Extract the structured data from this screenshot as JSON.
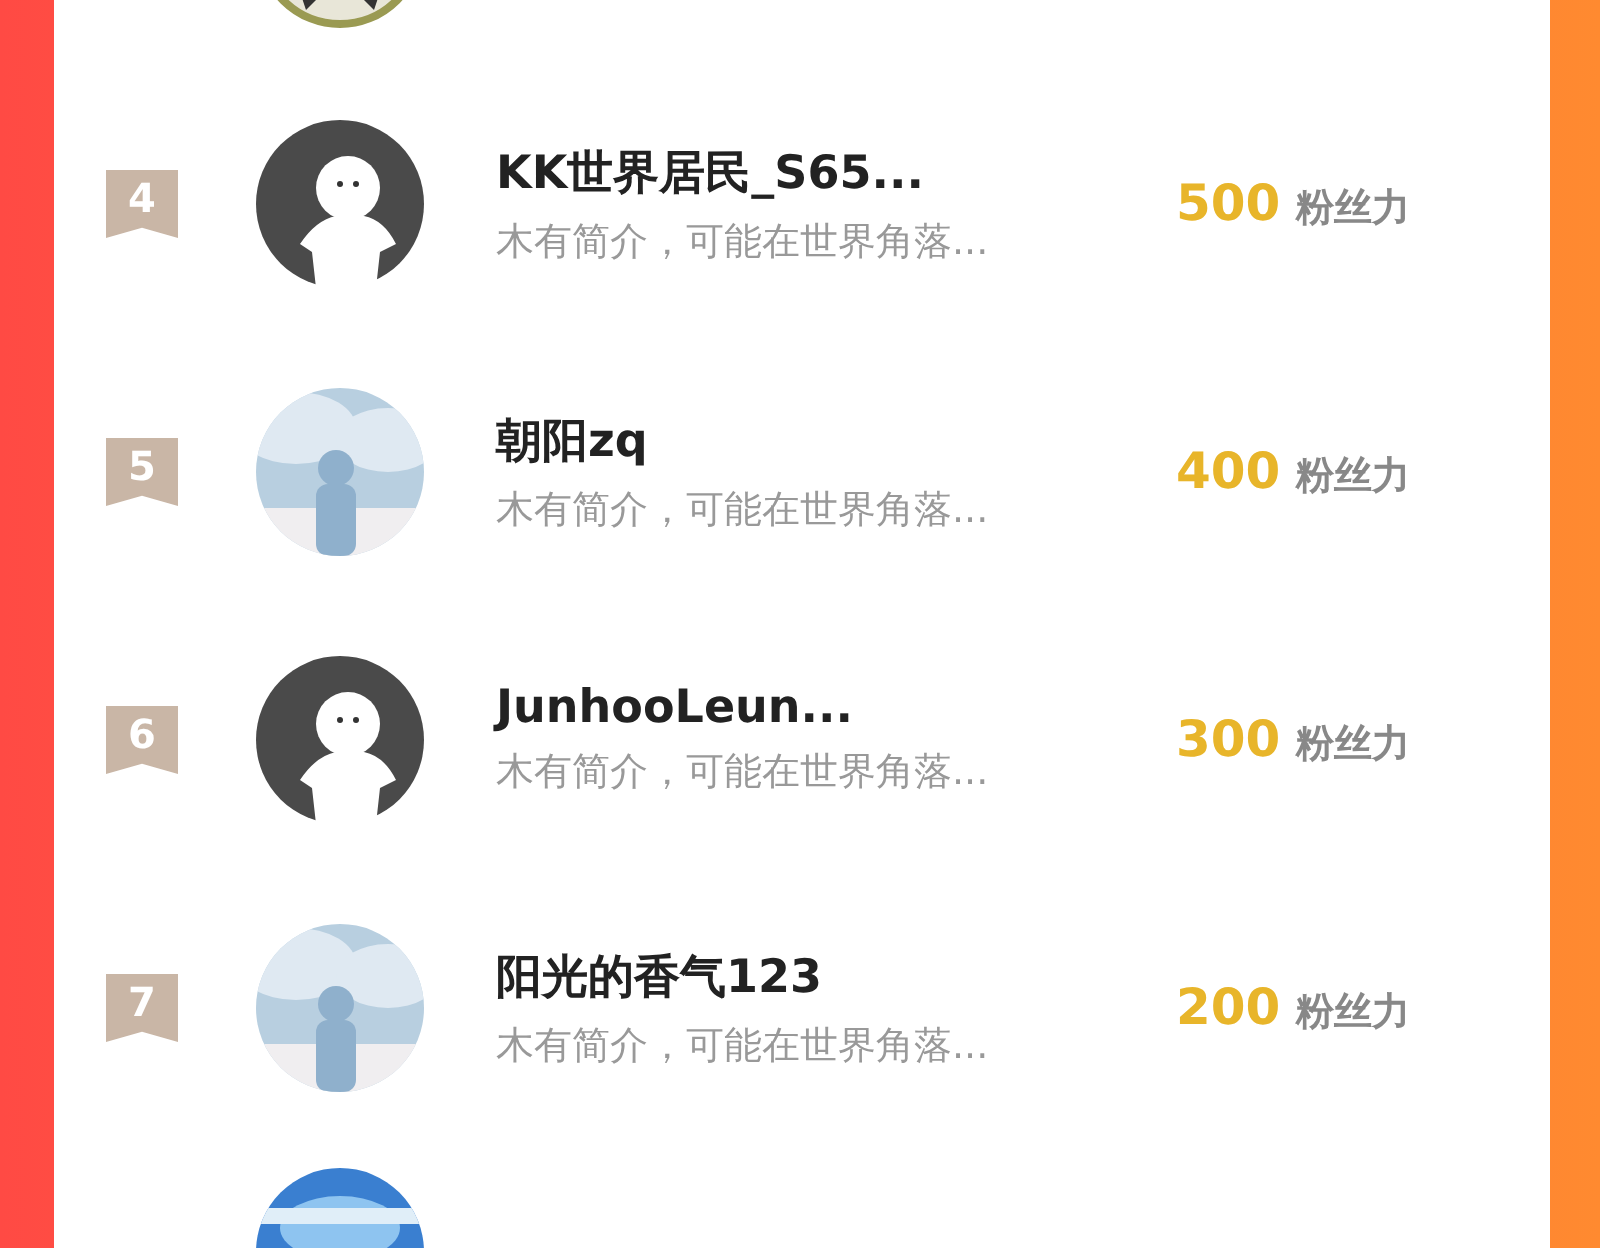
{
  "rows": [
    {
      "rank": "4",
      "kind": "default",
      "name": "KK世界居民_S65...",
      "bio": "木有简介，可能在世界角落...",
      "count": "500",
      "unit": "粉丝力"
    },
    {
      "rank": "5",
      "kind": "picture",
      "name": "朝阳zq",
      "bio": "木有简介，可能在世界角落...",
      "count": "400",
      "unit": "粉丝力"
    },
    {
      "rank": "6",
      "kind": "default",
      "name": "JunhooLeun...",
      "bio": "木有简介，可能在世界角落...",
      "count": "300",
      "unit": "粉丝力"
    },
    {
      "rank": "7",
      "kind": "picture",
      "name": "阳光的香气123",
      "bio": "木有简介，可能在世界角落...",
      "count": "200",
      "unit": "粉丝力"
    }
  ]
}
